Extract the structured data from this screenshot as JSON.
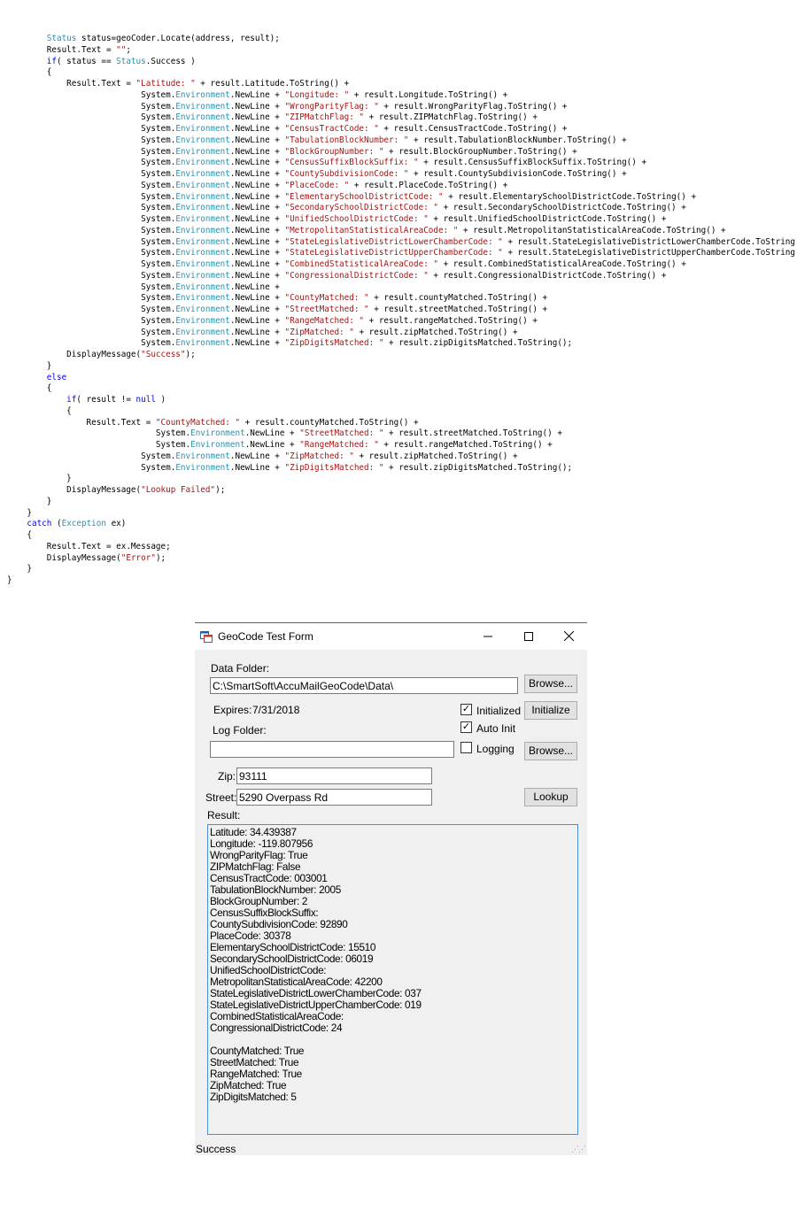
{
  "code_lines": [
    [
      {
        "t": "        "
      },
      {
        "c": "ty",
        "t": "Status"
      },
      {
        "t": " status=geoCoder.Locate(address, result);"
      }
    ],
    [
      {
        "t": "        Result.Text = "
      },
      {
        "c": "st",
        "t": "\"\""
      },
      {
        "t": ";"
      }
    ],
    [
      {
        "t": "        "
      },
      {
        "c": "kw",
        "t": "if"
      },
      {
        "t": "( status == "
      },
      {
        "c": "ty",
        "t": "Status"
      },
      {
        "t": ".Success )"
      }
    ],
    [
      {
        "t": "        {"
      }
    ],
    [
      {
        "t": "            Result.Text = "
      },
      {
        "c": "st",
        "t": "\"Latitude: \""
      },
      {
        "t": " + result.Latitude.ToString() +"
      }
    ],
    [
      {
        "t": "                           System."
      },
      {
        "c": "ty",
        "t": "Environment"
      },
      {
        "t": ".NewLine + "
      },
      {
        "c": "st",
        "t": "\"Longitude: \""
      },
      {
        "t": " + result.Longitude.ToString() +"
      }
    ],
    [
      {
        "t": "                           System."
      },
      {
        "c": "ty",
        "t": "Environment"
      },
      {
        "t": ".NewLine + "
      },
      {
        "c": "st",
        "t": "\"WrongParityFlag: \""
      },
      {
        "t": " + result.WrongParityFlag.ToString() +"
      }
    ],
    [
      {
        "t": "                           System."
      },
      {
        "c": "ty",
        "t": "Environment"
      },
      {
        "t": ".NewLine + "
      },
      {
        "c": "st",
        "t": "\"ZIPMatchFlag: \""
      },
      {
        "t": " + result.ZIPMatchFlag.ToString() +"
      }
    ],
    [
      {
        "t": "                           System."
      },
      {
        "c": "ty",
        "t": "Environment"
      },
      {
        "t": ".NewLine + "
      },
      {
        "c": "st",
        "t": "\"CensusTractCode: \""
      },
      {
        "t": " + result.CensusTractCode.ToString() +"
      }
    ],
    [
      {
        "t": "                           System."
      },
      {
        "c": "ty",
        "t": "Environment"
      },
      {
        "t": ".NewLine + "
      },
      {
        "c": "st",
        "t": "\"TabulationBlockNumber: \""
      },
      {
        "t": " + result.TabulationBlockNumber.ToString() +"
      }
    ],
    [
      {
        "t": "                           System."
      },
      {
        "c": "ty",
        "t": "Environment"
      },
      {
        "t": ".NewLine + "
      },
      {
        "c": "st",
        "t": "\"BlockGroupNumber: \""
      },
      {
        "t": " + result.BlockGroupNumber.ToString() +"
      }
    ],
    [
      {
        "t": "                           System."
      },
      {
        "c": "ty",
        "t": "Environment"
      },
      {
        "t": ".NewLine + "
      },
      {
        "c": "st",
        "t": "\"CensusSuffixBlockSuffix: \""
      },
      {
        "t": " + result.CensusSuffixBlockSuffix.ToString() +"
      }
    ],
    [
      {
        "t": "                           System."
      },
      {
        "c": "ty",
        "t": "Environment"
      },
      {
        "t": ".NewLine + "
      },
      {
        "c": "st",
        "t": "\"CountySubdivisionCode: \""
      },
      {
        "t": " + result.CountySubdivisionCode.ToString() +"
      }
    ],
    [
      {
        "t": "                           System."
      },
      {
        "c": "ty",
        "t": "Environment"
      },
      {
        "t": ".NewLine + "
      },
      {
        "c": "st",
        "t": "\"PlaceCode: \""
      },
      {
        "t": " + result.PlaceCode.ToString() +"
      }
    ],
    [
      {
        "t": "                           System."
      },
      {
        "c": "ty",
        "t": "Environment"
      },
      {
        "t": ".NewLine + "
      },
      {
        "c": "st",
        "t": "\"ElementarySchoolDistrictCode: \""
      },
      {
        "t": " + result.ElementarySchoolDistrictCode.ToString() +"
      }
    ],
    [
      {
        "t": "                           System."
      },
      {
        "c": "ty",
        "t": "Environment"
      },
      {
        "t": ".NewLine + "
      },
      {
        "c": "st",
        "t": "\"SecondarySchoolDistrictCode: \""
      },
      {
        "t": " + result.SecondarySchoolDistrictCode.ToString() +"
      }
    ],
    [
      {
        "t": "                           System."
      },
      {
        "c": "ty",
        "t": "Environment"
      },
      {
        "t": ".NewLine + "
      },
      {
        "c": "st",
        "t": "\"UnifiedSchoolDistrictCode: \""
      },
      {
        "t": " + result.UnifiedSchoolDistrictCode.ToString() +"
      }
    ],
    [
      {
        "t": "                           System."
      },
      {
        "c": "ty",
        "t": "Environment"
      },
      {
        "t": ".NewLine + "
      },
      {
        "c": "st",
        "t": "\"MetropolitanStatisticalAreaCode: \""
      },
      {
        "t": " + result.MetropolitanStatisticalAreaCode.ToString() +"
      }
    ],
    [
      {
        "t": "                           System."
      },
      {
        "c": "ty",
        "t": "Environment"
      },
      {
        "t": ".NewLine + "
      },
      {
        "c": "st",
        "t": "\"StateLegislativeDistrictLowerChamberCode: \""
      },
      {
        "t": " + result.StateLegislativeDistrictLowerChamberCode.ToString() +"
      }
    ],
    [
      {
        "t": "                           System."
      },
      {
        "c": "ty",
        "t": "Environment"
      },
      {
        "t": ".NewLine + "
      },
      {
        "c": "st",
        "t": "\"StateLegislativeDistrictUpperChamberCode: \""
      },
      {
        "t": " + result.StateLegislativeDistrictUpperChamberCode.ToString() +"
      }
    ],
    [
      {
        "t": "                           System."
      },
      {
        "c": "ty",
        "t": "Environment"
      },
      {
        "t": ".NewLine + "
      },
      {
        "c": "st",
        "t": "\"CombinedStatisticalAreaCode: \""
      },
      {
        "t": " + result.CombinedStatisticalAreaCode.ToString() +"
      }
    ],
    [
      {
        "t": "                           System."
      },
      {
        "c": "ty",
        "t": "Environment"
      },
      {
        "t": ".NewLine + "
      },
      {
        "c": "st",
        "t": "\"CongressionalDistrictCode: \""
      },
      {
        "t": " + result.CongressionalDistrictCode.ToString() +"
      }
    ],
    [
      {
        "t": "                           System."
      },
      {
        "c": "ty",
        "t": "Environment"
      },
      {
        "t": ".NewLine +"
      }
    ],
    [
      {
        "t": "                           System."
      },
      {
        "c": "ty",
        "t": "Environment"
      },
      {
        "t": ".NewLine + "
      },
      {
        "c": "st",
        "t": "\"CountyMatched: \""
      },
      {
        "t": " + result.countyMatched.ToString() +"
      }
    ],
    [
      {
        "t": "                           System."
      },
      {
        "c": "ty",
        "t": "Environment"
      },
      {
        "t": ".NewLine + "
      },
      {
        "c": "st",
        "t": "\"StreetMatched: \""
      },
      {
        "t": " + result.streetMatched.ToString() +"
      }
    ],
    [
      {
        "t": "                           System."
      },
      {
        "c": "ty",
        "t": "Environment"
      },
      {
        "t": ".NewLine + "
      },
      {
        "c": "st",
        "t": "\"RangeMatched: \""
      },
      {
        "t": " + result.rangeMatched.ToString() +"
      }
    ],
    [
      {
        "t": "                           System."
      },
      {
        "c": "ty",
        "t": "Environment"
      },
      {
        "t": ".NewLine + "
      },
      {
        "c": "st",
        "t": "\"ZipMatched: \""
      },
      {
        "t": " + result.zipMatched.ToString() +"
      }
    ],
    [
      {
        "t": "                           System."
      },
      {
        "c": "ty",
        "t": "Environment"
      },
      {
        "t": ".NewLine + "
      },
      {
        "c": "st",
        "t": "\"ZipDigitsMatched: \""
      },
      {
        "t": " + result.zipDigitsMatched.ToString();"
      }
    ],
    [
      {
        "t": "            DisplayMessage("
      },
      {
        "c": "st",
        "t": "\"Success\""
      },
      {
        "t": ");"
      }
    ],
    [
      {
        "t": "        }"
      }
    ],
    [
      {
        "t": "        "
      },
      {
        "c": "kw",
        "t": "else"
      }
    ],
    [
      {
        "t": "        {"
      }
    ],
    [
      {
        "t": "            "
      },
      {
        "c": "kw",
        "t": "if"
      },
      {
        "t": "( result != "
      },
      {
        "c": "kw",
        "t": "null"
      },
      {
        "t": " )"
      }
    ],
    [
      {
        "t": "            {"
      }
    ],
    [
      {
        "t": "                Result.Text = "
      },
      {
        "c": "st",
        "t": "\"CountyMatched: \""
      },
      {
        "t": " + result.countyMatched.ToString() +"
      }
    ],
    [
      {
        "t": "                              System."
      },
      {
        "c": "ty",
        "t": "Environment"
      },
      {
        "t": ".NewLine + "
      },
      {
        "c": "st",
        "t": "\"StreetMatched: \""
      },
      {
        "t": " + result.streetMatched.ToString() +"
      }
    ],
    [
      {
        "t": "                              System."
      },
      {
        "c": "ty",
        "t": "Environment"
      },
      {
        "t": ".NewLine + "
      },
      {
        "c": "st",
        "t": "\"RangeMatched: \""
      },
      {
        "t": " + result.rangeMatched.ToString() +"
      }
    ],
    [
      {
        "t": "                           System."
      },
      {
        "c": "ty",
        "t": "Environment"
      },
      {
        "t": ".NewLine + "
      },
      {
        "c": "st",
        "t": "\"ZipMatched: \""
      },
      {
        "t": " + result.zipMatched.ToString() +"
      }
    ],
    [
      {
        "t": "                           System."
      },
      {
        "c": "ty",
        "t": "Environment"
      },
      {
        "t": ".NewLine + "
      },
      {
        "c": "st",
        "t": "\"ZipDigitsMatched: \""
      },
      {
        "t": " + result.zipDigitsMatched.ToString();"
      }
    ],
    [
      {
        "t": "            }"
      }
    ],
    [
      {
        "t": "            DisplayMessage("
      },
      {
        "c": "st",
        "t": "\"Lookup Failed\""
      },
      {
        "t": ");"
      }
    ],
    [
      {
        "t": "        }"
      }
    ],
    [
      {
        "t": "    }"
      }
    ],
    [
      {
        "t": "    "
      },
      {
        "c": "kw",
        "t": "catch"
      },
      {
        "t": " ("
      },
      {
        "c": "ty",
        "t": "Exception"
      },
      {
        "t": " ex)"
      }
    ],
    [
      {
        "t": "    {"
      }
    ],
    [
      {
        "t": "        Result.Text = ex.Message;"
      }
    ],
    [
      {
        "t": "        DisplayMessage("
      },
      {
        "c": "st",
        "t": "\"Error\""
      },
      {
        "t": ");"
      }
    ],
    [
      {
        "t": "    }"
      }
    ],
    [
      {
        "t": "}"
      }
    ]
  ],
  "colors": {
    "keyword": "#0000ff",
    "type": "#2b91af",
    "string": "#a31515",
    "accent": "#1a73b5"
  },
  "window": {
    "title": "GeoCode Test Form",
    "icons": {
      "app": "form-icon",
      "minimize": "minimize-icon",
      "maximize": "maximize-icon",
      "close": "close-icon"
    },
    "data_folder_label": "Data Folder:",
    "data_folder_value": "C:\\SmartSoft\\AccuMailGeoCode\\Data\\",
    "browse_label": "Browse...",
    "expires_label": "Expires:",
    "expires_value": "7/31/2018",
    "initialized_label": "Initialized",
    "initialized_checked": true,
    "initialize_button": "Initialize",
    "log_folder_label": "Log Folder:",
    "log_folder_value": "",
    "auto_init_label": "Auto Init",
    "auto_init_checked": true,
    "logging_label": "Logging",
    "logging_checked": false,
    "log_browse_label": "Browse...",
    "zip_label": "Zip:",
    "zip_value": "93111",
    "street_label": "Street:",
    "street_value": "5290 Overpass Rd",
    "lookup_button": "Lookup",
    "result_label": "Result:",
    "result_lines": [
      "Latitude: 34.439387",
      "Longitude: -119.807956",
      "WrongParityFlag: True",
      "ZIPMatchFlag: False",
      "CensusTractCode: 003001",
      "TabulationBlockNumber: 2005",
      "BlockGroupNumber: 2",
      "CensusSuffixBlockSuffix:",
      "CountySubdivisionCode: 92890",
      "PlaceCode: 30378",
      "ElementarySchoolDistrictCode: 15510",
      "SecondarySchoolDistrictCode: 06019",
      "UnifiedSchoolDistrictCode:",
      "MetropolitanStatisticalAreaCode: 42200",
      "StateLegislativeDistrictLowerChamberCode: 037",
      "StateLegislativeDistrictUpperChamberCode: 019",
      "CombinedStatisticalAreaCode:",
      "CongressionalDistrictCode: 24",
      "",
      "CountyMatched: True",
      "StreetMatched: True",
      "RangeMatched: True",
      "ZipMatched: True",
      "ZipDigitsMatched: 5"
    ],
    "status_text": "Success"
  }
}
